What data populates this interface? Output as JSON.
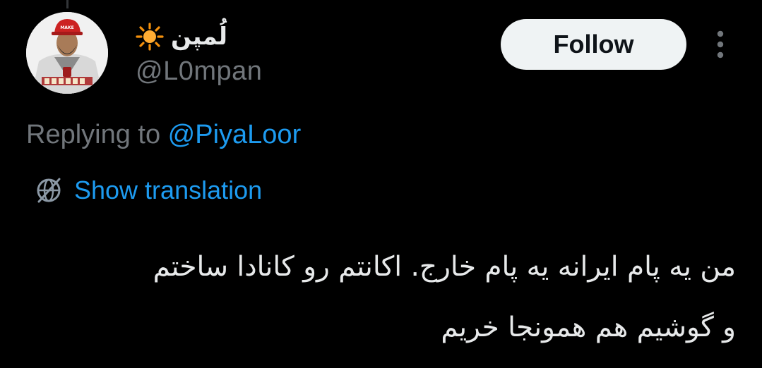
{
  "author": {
    "display_name": "لُمپن",
    "name_emoji_icon": "sun-icon",
    "handle": "@L0mpan",
    "avatar_icon": "avatar-illustration"
  },
  "actions": {
    "follow_label": "Follow",
    "more_icon": "more-vertical-icon"
  },
  "reply": {
    "prefix": "Replying to ",
    "target_handle": "@PiyaLoor"
  },
  "translation": {
    "icon": "globe-icon",
    "label": "Show translation"
  },
  "tweet": {
    "lines": [
      "من یه پام ایرانه یه پام خارج. اکانتم رو کانادا ساختم",
      "و گوشیم هم همونجا خریم"
    ]
  },
  "colors": {
    "background": "#000000",
    "primary_text": "#e7e9ea",
    "secondary_text": "#71767b",
    "link": "#1d9bf0",
    "follow_button_bg": "#eff3f4",
    "follow_button_text": "#0f1419"
  }
}
